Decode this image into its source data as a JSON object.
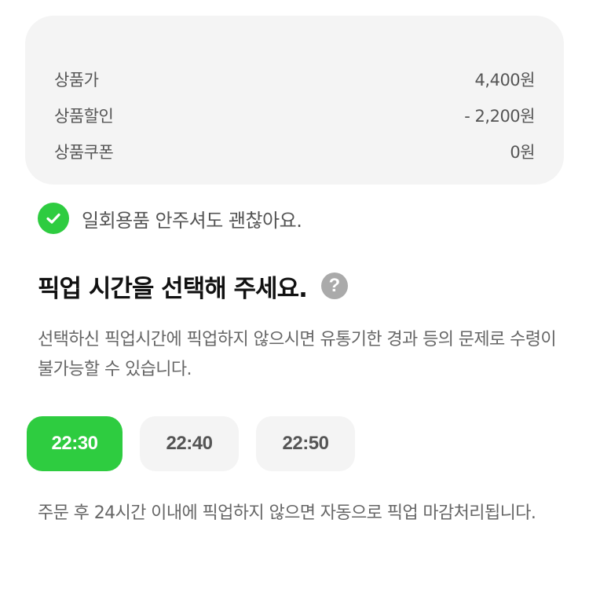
{
  "price_summary": {
    "rows": [
      {
        "label": "상품가",
        "value": "4,400원"
      },
      {
        "label": "상품할인",
        "value": "- 2,200원"
      },
      {
        "label": "상품쿠폰",
        "value": "0원"
      }
    ]
  },
  "disposables_option": {
    "checked": true,
    "label": "일회용품 안주셔도 괜찮아요."
  },
  "pickup_section": {
    "title": "픽업 시간을 선택해 주세요.",
    "help_symbol": "?",
    "description": "선택하신 픽업시간에 픽업하지 않으시면 유통기한 경과 등의 문제로 수령이 불가능할 수 있습니다.",
    "time_options": [
      {
        "label": "22:30",
        "selected": true
      },
      {
        "label": "22:40",
        "selected": false
      },
      {
        "label": "22:50",
        "selected": false
      }
    ],
    "note": "주문 후 24시간 이내에 픽업하지 않으면 자동으로 픽업 마감처리됩니다."
  },
  "colors": {
    "accent": "#2ecc40",
    "card_bg": "#f4f4f4",
    "muted_text": "#666666"
  },
  "icons": {
    "check": "check-circle-icon",
    "help": "question-circle-icon"
  }
}
